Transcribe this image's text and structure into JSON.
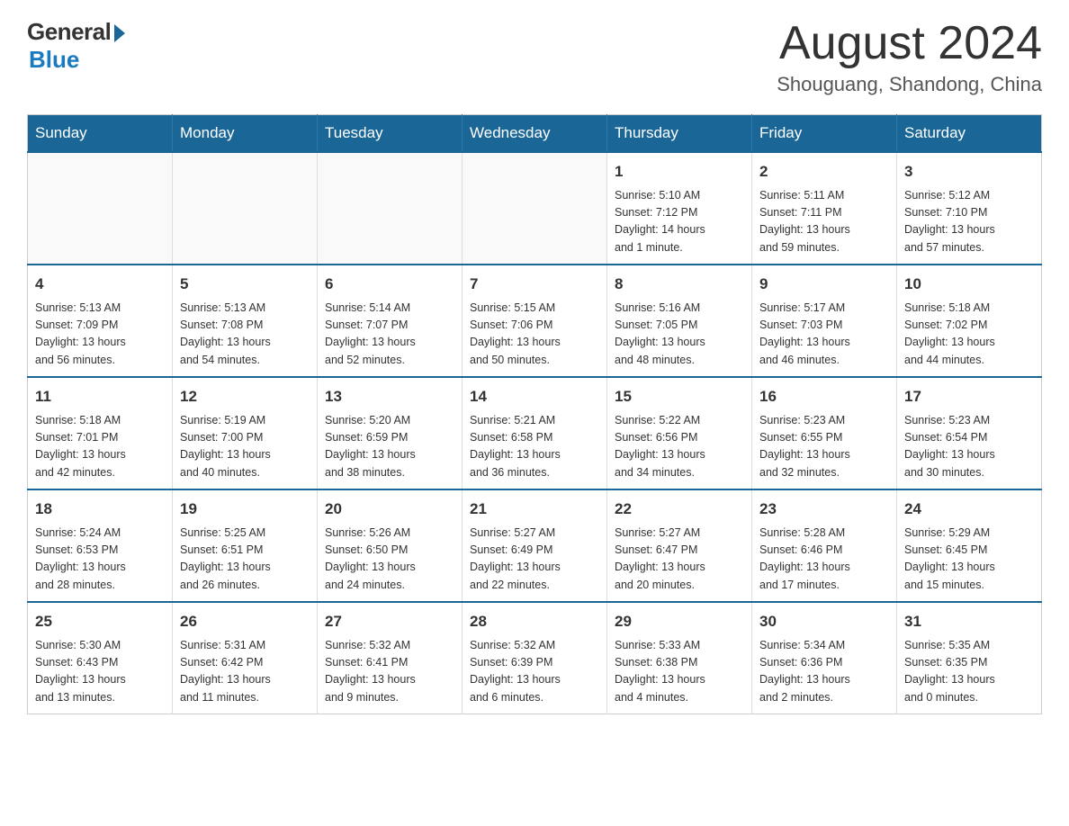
{
  "logo": {
    "general": "General",
    "blue": "Blue"
  },
  "title": "August 2024",
  "location": "Shouguang, Shandong, China",
  "weekdays": [
    "Sunday",
    "Monday",
    "Tuesday",
    "Wednesday",
    "Thursday",
    "Friday",
    "Saturday"
  ],
  "weeks": [
    [
      {
        "day": "",
        "info": ""
      },
      {
        "day": "",
        "info": ""
      },
      {
        "day": "",
        "info": ""
      },
      {
        "day": "",
        "info": ""
      },
      {
        "day": "1",
        "info": "Sunrise: 5:10 AM\nSunset: 7:12 PM\nDaylight: 14 hours\nand 1 minute."
      },
      {
        "day": "2",
        "info": "Sunrise: 5:11 AM\nSunset: 7:11 PM\nDaylight: 13 hours\nand 59 minutes."
      },
      {
        "day": "3",
        "info": "Sunrise: 5:12 AM\nSunset: 7:10 PM\nDaylight: 13 hours\nand 57 minutes."
      }
    ],
    [
      {
        "day": "4",
        "info": "Sunrise: 5:13 AM\nSunset: 7:09 PM\nDaylight: 13 hours\nand 56 minutes."
      },
      {
        "day": "5",
        "info": "Sunrise: 5:13 AM\nSunset: 7:08 PM\nDaylight: 13 hours\nand 54 minutes."
      },
      {
        "day": "6",
        "info": "Sunrise: 5:14 AM\nSunset: 7:07 PM\nDaylight: 13 hours\nand 52 minutes."
      },
      {
        "day": "7",
        "info": "Sunrise: 5:15 AM\nSunset: 7:06 PM\nDaylight: 13 hours\nand 50 minutes."
      },
      {
        "day": "8",
        "info": "Sunrise: 5:16 AM\nSunset: 7:05 PM\nDaylight: 13 hours\nand 48 minutes."
      },
      {
        "day": "9",
        "info": "Sunrise: 5:17 AM\nSunset: 7:03 PM\nDaylight: 13 hours\nand 46 minutes."
      },
      {
        "day": "10",
        "info": "Sunrise: 5:18 AM\nSunset: 7:02 PM\nDaylight: 13 hours\nand 44 minutes."
      }
    ],
    [
      {
        "day": "11",
        "info": "Sunrise: 5:18 AM\nSunset: 7:01 PM\nDaylight: 13 hours\nand 42 minutes."
      },
      {
        "day": "12",
        "info": "Sunrise: 5:19 AM\nSunset: 7:00 PM\nDaylight: 13 hours\nand 40 minutes."
      },
      {
        "day": "13",
        "info": "Sunrise: 5:20 AM\nSunset: 6:59 PM\nDaylight: 13 hours\nand 38 minutes."
      },
      {
        "day": "14",
        "info": "Sunrise: 5:21 AM\nSunset: 6:58 PM\nDaylight: 13 hours\nand 36 minutes."
      },
      {
        "day": "15",
        "info": "Sunrise: 5:22 AM\nSunset: 6:56 PM\nDaylight: 13 hours\nand 34 minutes."
      },
      {
        "day": "16",
        "info": "Sunrise: 5:23 AM\nSunset: 6:55 PM\nDaylight: 13 hours\nand 32 minutes."
      },
      {
        "day": "17",
        "info": "Sunrise: 5:23 AM\nSunset: 6:54 PM\nDaylight: 13 hours\nand 30 minutes."
      }
    ],
    [
      {
        "day": "18",
        "info": "Sunrise: 5:24 AM\nSunset: 6:53 PM\nDaylight: 13 hours\nand 28 minutes."
      },
      {
        "day": "19",
        "info": "Sunrise: 5:25 AM\nSunset: 6:51 PM\nDaylight: 13 hours\nand 26 minutes."
      },
      {
        "day": "20",
        "info": "Sunrise: 5:26 AM\nSunset: 6:50 PM\nDaylight: 13 hours\nand 24 minutes."
      },
      {
        "day": "21",
        "info": "Sunrise: 5:27 AM\nSunset: 6:49 PM\nDaylight: 13 hours\nand 22 minutes."
      },
      {
        "day": "22",
        "info": "Sunrise: 5:27 AM\nSunset: 6:47 PM\nDaylight: 13 hours\nand 20 minutes."
      },
      {
        "day": "23",
        "info": "Sunrise: 5:28 AM\nSunset: 6:46 PM\nDaylight: 13 hours\nand 17 minutes."
      },
      {
        "day": "24",
        "info": "Sunrise: 5:29 AM\nSunset: 6:45 PM\nDaylight: 13 hours\nand 15 minutes."
      }
    ],
    [
      {
        "day": "25",
        "info": "Sunrise: 5:30 AM\nSunset: 6:43 PM\nDaylight: 13 hours\nand 13 minutes."
      },
      {
        "day": "26",
        "info": "Sunrise: 5:31 AM\nSunset: 6:42 PM\nDaylight: 13 hours\nand 11 minutes."
      },
      {
        "day": "27",
        "info": "Sunrise: 5:32 AM\nSunset: 6:41 PM\nDaylight: 13 hours\nand 9 minutes."
      },
      {
        "day": "28",
        "info": "Sunrise: 5:32 AM\nSunset: 6:39 PM\nDaylight: 13 hours\nand 6 minutes."
      },
      {
        "day": "29",
        "info": "Sunrise: 5:33 AM\nSunset: 6:38 PM\nDaylight: 13 hours\nand 4 minutes."
      },
      {
        "day": "30",
        "info": "Sunrise: 5:34 AM\nSunset: 6:36 PM\nDaylight: 13 hours\nand 2 minutes."
      },
      {
        "day": "31",
        "info": "Sunrise: 5:35 AM\nSunset: 6:35 PM\nDaylight: 13 hours\nand 0 minutes."
      }
    ]
  ]
}
